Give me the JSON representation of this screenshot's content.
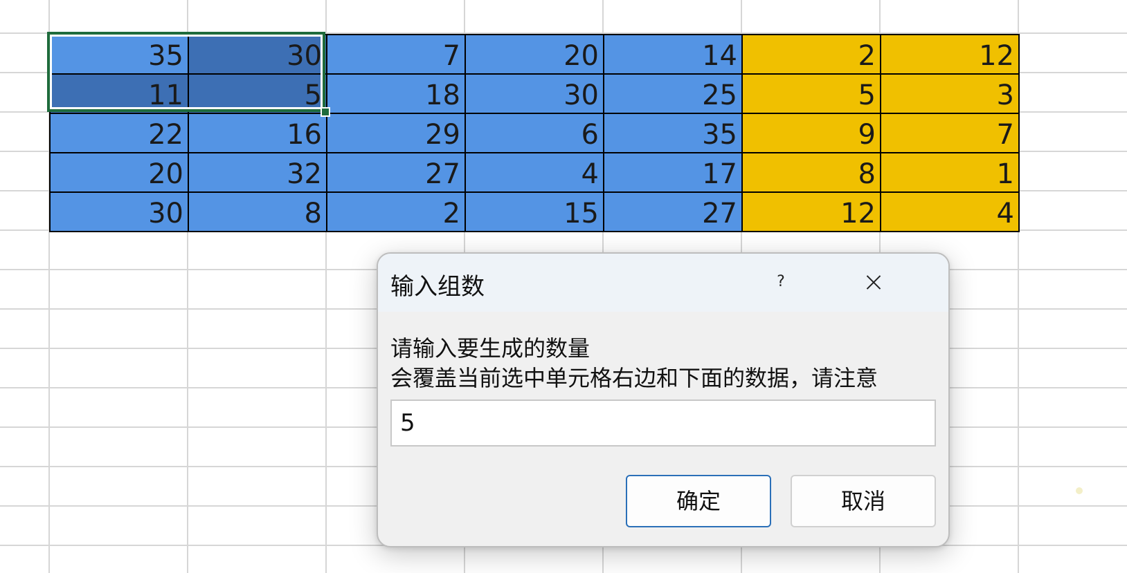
{
  "sheet": {
    "rows": [
      [
        35,
        30,
        7,
        20,
        14,
        2,
        12
      ],
      [
        11,
        5,
        18,
        30,
        25,
        5,
        3
      ],
      [
        22,
        16,
        29,
        6,
        35,
        9,
        7
      ],
      [
        20,
        32,
        27,
        4,
        17,
        8,
        1
      ],
      [
        30,
        8,
        2,
        15,
        27,
        12,
        4
      ]
    ],
    "column_fills": [
      "blue",
      "blue",
      "blue",
      "blue",
      "blue",
      "yellow",
      "yellow"
    ],
    "colors": {
      "blue": "#5494e4",
      "yellow": "#f0c000",
      "selection_border": "#1e6b3c"
    }
  },
  "dialog": {
    "title": "输入组数",
    "help_label": "?",
    "prompt_line1": "请输入要生成的数量",
    "prompt_line2": "会覆盖当前选中单元格右边和下面的数据，请注意",
    "input_value": "5",
    "ok_label": "确定",
    "cancel_label": "取消"
  }
}
